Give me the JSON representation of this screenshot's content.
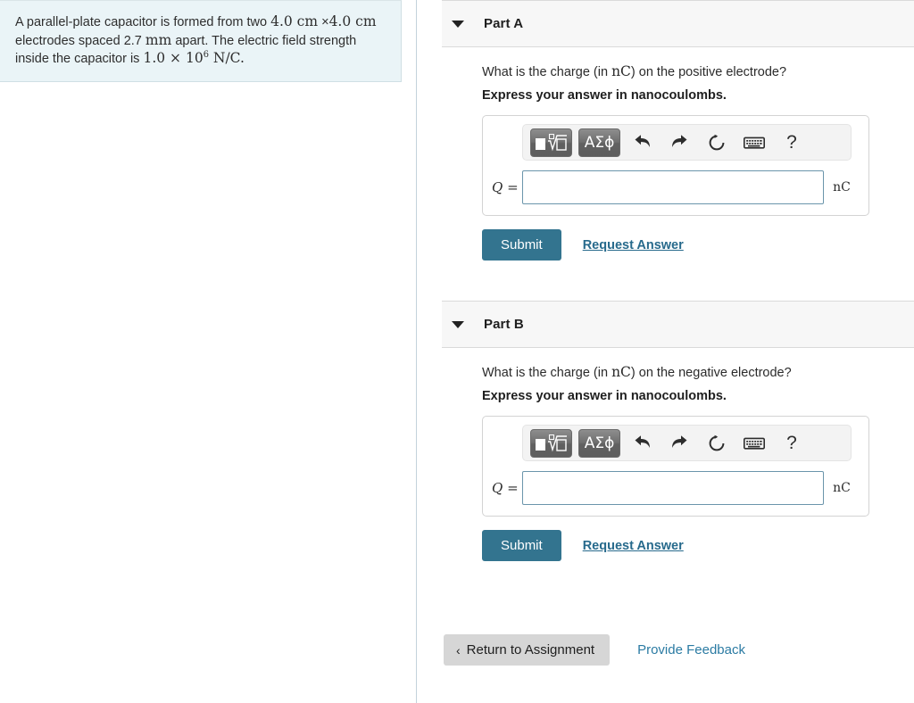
{
  "problem": {
    "line1_a": "A parallel-plate capacitor is formed from two ",
    "dim1": "4.0 cm",
    "times": " ×",
    "dim2": "4.0 cm",
    "line2_a": "electrodes spaced 2.7 ",
    "unit_mm": "mm",
    "line2_b": " apart. The electric field strength",
    "line3_a": "inside the capacitor is ",
    "field_mantissa": "1.0 × 10",
    "field_exponent": "6",
    "field_unit": " N/C."
  },
  "parts": [
    {
      "title": "Part A",
      "question_pre": "What is the charge (in ",
      "question_unit": "nC",
      "question_post": ") on the positive electrode?",
      "instruction": "Express your answer in nanocoulombs.",
      "toolbar": {
        "templates_label": "math-templates",
        "greek_label": "ΑΣϕ",
        "undo_label": "undo",
        "redo_label": "redo",
        "reset_label": "reset",
        "keyboard_label": "keyboard",
        "help_label": "?"
      },
      "variable_label": "Q",
      "equals": " =",
      "input_value": "",
      "input_placeholder": "",
      "unit": "nC",
      "submit_label": "Submit",
      "request_label": "Request Answer"
    },
    {
      "title": "Part B",
      "question_pre": "What is the charge (in ",
      "question_unit": "nC",
      "question_post": ") on the negative electrode?",
      "instruction": "Express your answer in nanocoulombs.",
      "toolbar": {
        "templates_label": "math-templates",
        "greek_label": "ΑΣϕ",
        "undo_label": "undo",
        "redo_label": "redo",
        "reset_label": "reset",
        "keyboard_label": "keyboard",
        "help_label": "?"
      },
      "variable_label": "Q",
      "equals": " =",
      "input_value": "",
      "input_placeholder": "",
      "unit": "nC",
      "submit_label": "Submit",
      "request_label": "Request Answer"
    }
  ],
  "footer": {
    "return_label": "Return to Assignment",
    "return_chevron": "‹",
    "feedback_label": "Provide Feedback"
  },
  "colors": {
    "problem_bg": "#eaf4f7",
    "submit_bg": "#33748f",
    "link": "#276a8c",
    "feedback_link": "#2b7ba3",
    "part_header_bg": "#f7f7f7",
    "input_border": "#6b95ab",
    "return_bg": "#d6d6d6"
  }
}
